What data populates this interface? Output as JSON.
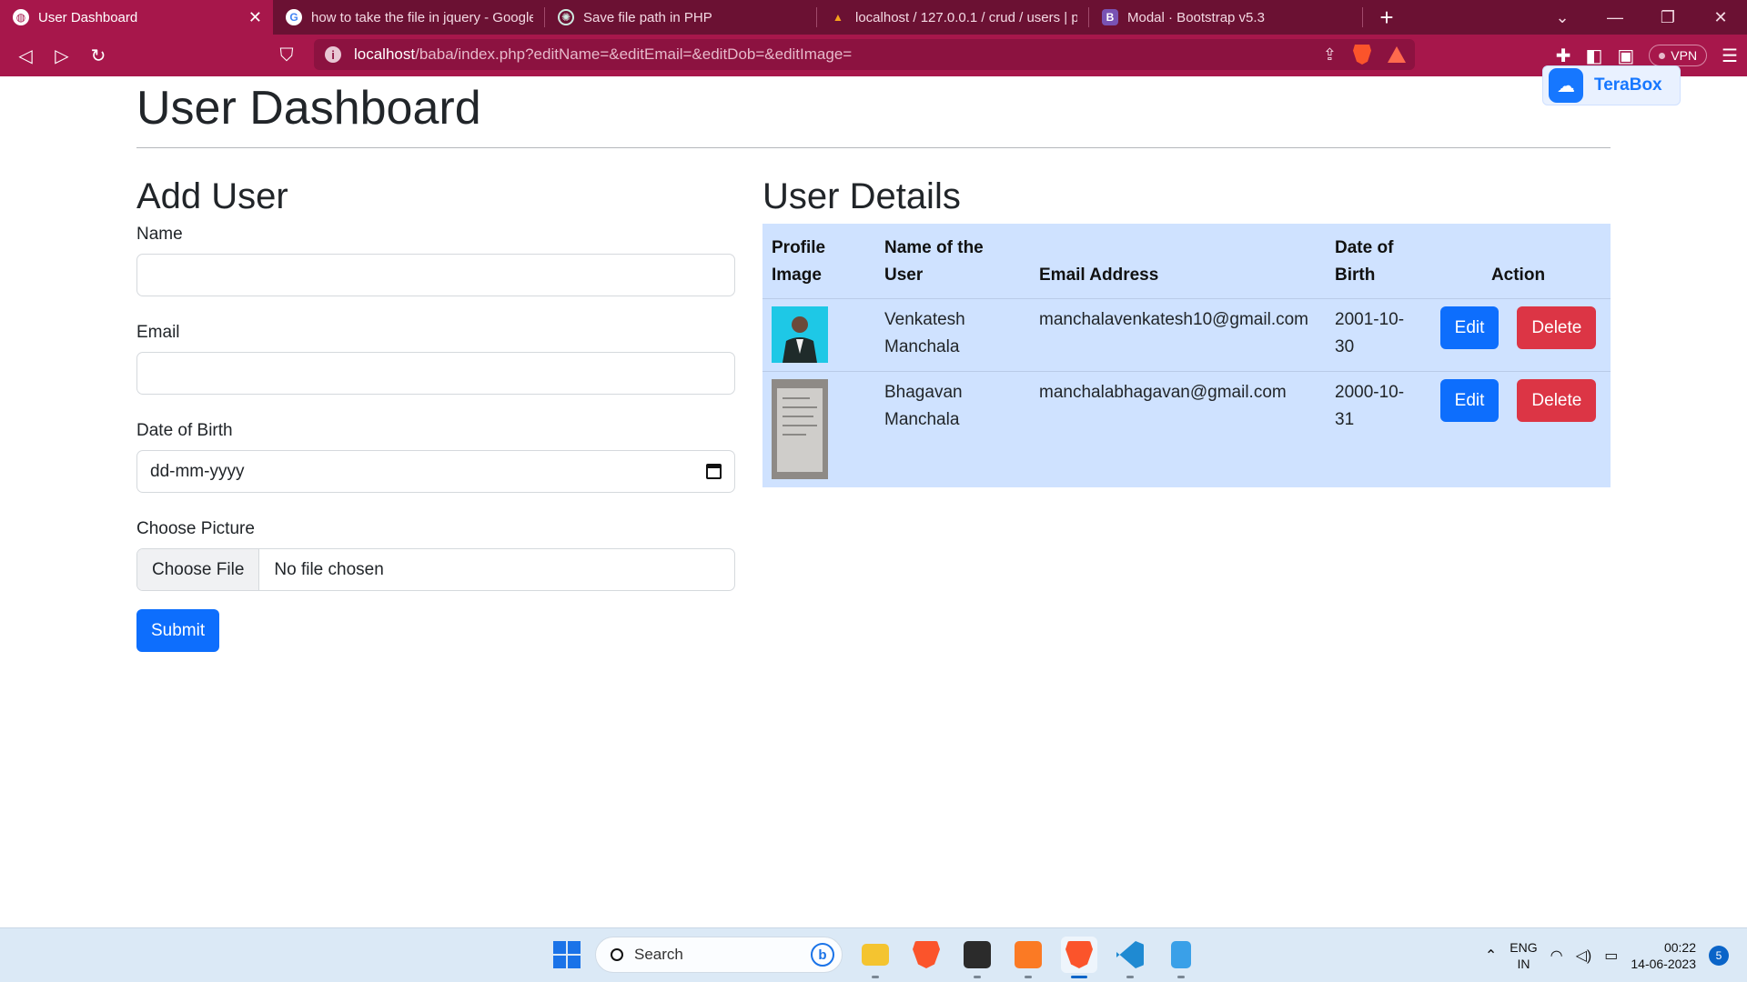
{
  "browser": {
    "tabs": [
      {
        "title": "User Dashboard",
        "active": true,
        "icon": "globe-icon"
      },
      {
        "title": "how to take the file in jquery - Google",
        "active": false,
        "icon": "google-icon"
      },
      {
        "title": "Save file path in PHP",
        "active": false,
        "icon": "chatgpt-icon"
      },
      {
        "title": "localhost / 127.0.0.1 / crud / users | ph",
        "active": false,
        "icon": "phpmyadmin-icon"
      },
      {
        "title": "Modal · Bootstrap v5.3",
        "active": false,
        "icon": "bootstrap-icon"
      }
    ],
    "url_host": "localhost",
    "url_path": "/baba/index.php?editName=&editEmail=&editDob=&editImage=",
    "vpn_label": "VPN",
    "theme_color": "#a7174b"
  },
  "page": {
    "title": "User Dashboard",
    "form": {
      "heading": "Add User",
      "name_label": "Name",
      "email_label": "Email",
      "dob_label": "Date of Birth",
      "dob_placeholder": "dd-mm-yyyy",
      "picture_label": "Choose Picture",
      "file_button": "Choose File",
      "file_status": "No file chosen",
      "submit_label": "Submit"
    },
    "table": {
      "heading": "User Details",
      "columns": [
        "Profile Image",
        "Name of the User",
        "Email Address",
        "Date of Birth",
        "Action"
      ],
      "rows": [
        {
          "name": "Venkatesh Manchala",
          "email": "manchalavenkatesh10@gmail.com",
          "dob": "2001-10-30",
          "edit": "Edit",
          "delete": "Delete"
        },
        {
          "name": "Bhagavan Manchala",
          "email": "manchalabhagavan@gmail.com",
          "dob": "2000-10-31",
          "edit": "Edit",
          "delete": "Delete"
        }
      ]
    }
  },
  "terabox": {
    "label": "TeraBox"
  },
  "taskbar": {
    "search_placeholder": "Search",
    "lang_top": "ENG",
    "lang_bottom": "IN",
    "time": "00:22",
    "date": "14-06-2023",
    "notifications": "5"
  }
}
